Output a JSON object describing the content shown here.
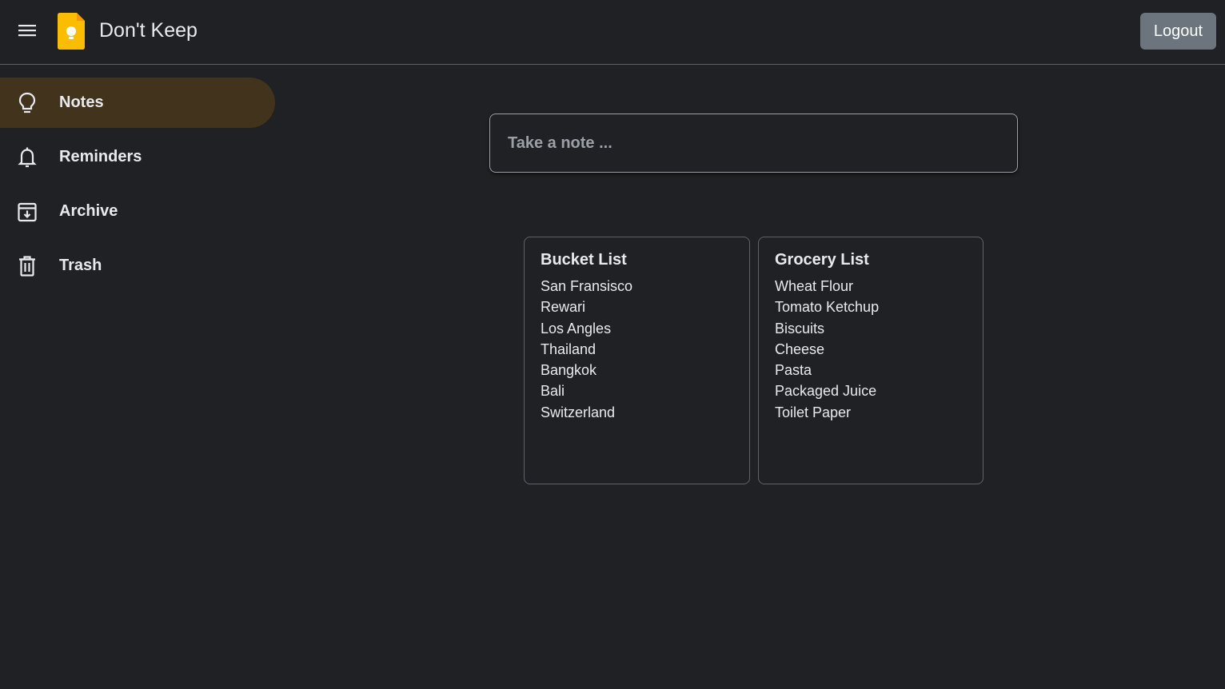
{
  "header": {
    "title": "Don't Keep",
    "menu_icon": "hamburger-menu-icon",
    "logo_icon": "keep-bulb-logo",
    "logout_label": "Logout",
    "logo_color": "#fbbc04"
  },
  "sidebar": {
    "active_color": "#41331c",
    "items": [
      {
        "label": "Notes",
        "icon": "lightbulb-icon",
        "active": true
      },
      {
        "label": "Reminders",
        "icon": "bell-icon",
        "active": false
      },
      {
        "label": "Archive",
        "icon": "archive-icon",
        "active": false
      },
      {
        "label": "Trash",
        "icon": "trash-icon",
        "active": false
      }
    ]
  },
  "composer": {
    "placeholder": "Take a note ..."
  },
  "notes": [
    {
      "title": "Bucket List",
      "items": [
        "San Fransisco",
        "Rewari",
        "Los Angles",
        "Thailand",
        "Bangkok",
        "Bali",
        "Switzerland"
      ]
    },
    {
      "title": "Grocery List",
      "items": [
        "Wheat Flour",
        "Tomato Ketchup",
        "Biscuits",
        "Cheese",
        "Pasta",
        "Packaged Juice",
        "Toilet Paper"
      ]
    }
  ]
}
